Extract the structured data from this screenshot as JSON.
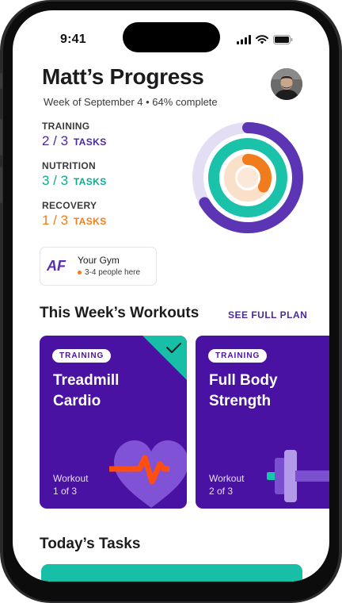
{
  "status_bar": {
    "time": "9:41"
  },
  "header": {
    "title": "Matt’s Progress",
    "subtitle": "Week of September 4 • 64% complete",
    "completion_percent": 64
  },
  "stats": [
    {
      "label": "TRAINING",
      "value": "2 / 3",
      "unit": "TASKS",
      "color": "#4a2a9c",
      "done": 2,
      "total": 3
    },
    {
      "label": "NUTRITION",
      "value": "3 / 3",
      "unit": "TASKS",
      "color": "#12a98f",
      "done": 3,
      "total": 3
    },
    {
      "label": "RECOVERY",
      "value": "1 / 3",
      "unit": "TASKS",
      "color": "#f07c1d",
      "done": 1,
      "total": 3
    }
  ],
  "gym": {
    "logo_text": "AF",
    "name": "Your Gym",
    "status": "3-4 people here",
    "status_color": "#f07c1d"
  },
  "workouts_section": {
    "title": "This Week’s Workouts",
    "link": "SEE FULL PLAN",
    "cards": [
      {
        "badge": "TRAINING",
        "title": "Treadmill Cardio",
        "meta_line1": "Workout",
        "meta_line2": "1 of 3",
        "completed": true,
        "icon": "heart-pulse-icon"
      },
      {
        "badge": "TRAINING",
        "title": "Full Body Strength",
        "meta_line1": "Workout",
        "meta_line2": "2 of 3",
        "completed": false,
        "icon": "dumbbell-icon"
      }
    ]
  },
  "tasks_section": {
    "title": "Today’s Tasks"
  },
  "colors": {
    "accent_purple": "#4a12a3",
    "teal": "#16bfa5",
    "orange": "#f07c1d"
  }
}
